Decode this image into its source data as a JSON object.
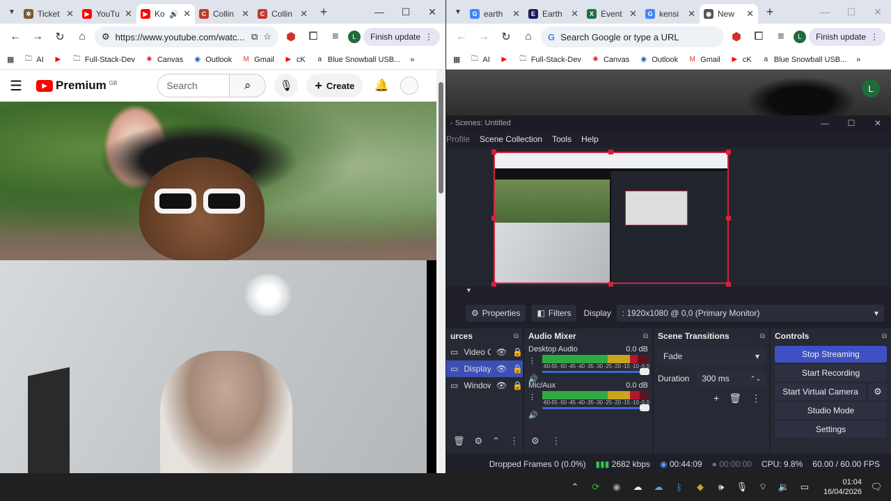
{
  "left_browser": {
    "tabs": [
      {
        "title": "Ticket",
        "icon": "gear-favicon-icon",
        "color": "#7a5a2a",
        "active": false
      },
      {
        "title": "YouTu",
        "icon": "youtube-favicon-icon",
        "color": "#ff0000",
        "active": false
      },
      {
        "title": "Ko",
        "icon": "youtube-favicon-icon",
        "color": "#ff0000",
        "active": true
      },
      {
        "title": "Collin",
        "icon": "collins-favicon-icon",
        "color": "#c0392b",
        "active": false
      },
      {
        "title": "Collin",
        "icon": "collins-favicon-icon",
        "color": "#c0392b",
        "active": false
      }
    ],
    "url": "https://www.youtube.com/watc...",
    "avatar_letter": "L",
    "finish_update": "Finish update",
    "bookmarks": [
      "AI",
      "",
      "Full-Stack-Dev",
      "Canvas",
      "Outlook",
      "Gmail",
      "cK",
      "Blue Snowball USB..."
    ]
  },
  "youtube": {
    "logo_text": "Premium",
    "logo_region": "GB",
    "search_placeholder": "Search",
    "create_label": "Create"
  },
  "right_browser": {
    "tabs": [
      {
        "title": "earth",
        "icon": "google-favicon-icon",
        "color": "#4285f4",
        "active": false
      },
      {
        "title": "Earth",
        "icon": "earth-favicon-icon",
        "color": "#1a1a5a",
        "active": false
      },
      {
        "title": "Event",
        "icon": "excel-favicon-icon",
        "color": "#1e7145",
        "active": false
      },
      {
        "title": "kensi",
        "icon": "google-favicon-icon",
        "color": "#4285f4",
        "active": false
      },
      {
        "title": "New",
        "icon": "chrome-favicon-icon",
        "color": "#555555",
        "active": true
      }
    ],
    "omnibox_placeholder": "Search Google or type a URL",
    "avatar_letter": "L",
    "finish_update": "Finish update",
    "bookmarks": [
      "AI",
      "",
      "Full-Stack-Dev",
      "Canvas",
      "Outlook",
      "Gmail",
      "cK",
      "Blue Snowball USB..."
    ],
    "page_avatar_letter": "L"
  },
  "obs": {
    "title": "- Scenes: Untitled",
    "menu": [
      "Profile",
      "Scene Collection",
      "Tools",
      "Help"
    ],
    "properties_label": "Properties",
    "filters_label": "Filters",
    "display_label": "Display",
    "display_value": ": 1920x1080 @ 0,0 (Primary Monitor)",
    "sources": {
      "title": "urces",
      "items": [
        {
          "name": "Video Cap",
          "selected": false
        },
        {
          "name": "Display Ca",
          "selected": true
        },
        {
          "name": "Window C",
          "selected": false
        }
      ]
    },
    "mixer": {
      "title": "Audio Mixer",
      "scale": "-60-55 -50 -45 -40 -35 -30 -25 -20 -15 -10 -5 0",
      "channels": [
        {
          "name": "Desktop Audio",
          "db": "0.0 dB",
          "level": 0.9
        },
        {
          "name": "Mic/Aux",
          "db": "0.0 dB",
          "level": 0.92
        }
      ]
    },
    "transitions": {
      "title": "Scene Transitions",
      "type": "Fade",
      "duration_label": "Duration",
      "duration_value": "300 ms"
    },
    "controls": {
      "title": "Controls",
      "stop_streaming": "Stop Streaming",
      "start_recording": "Start Recording",
      "start_virtual_camera": "Start Virtual Camera",
      "studio_mode": "Studio Mode",
      "settings": "Settings"
    },
    "status": {
      "dropped": "Dropped Frames 0 (0.0%)",
      "kbps": "2682 kbps",
      "stream_time": "00:44:09",
      "rec_time": "00:00:00",
      "cpu": "CPU: 9.8%",
      "fps": "60.00 / 60.00 FPS"
    },
    "accent_color": "#3d51c4",
    "selection_color": "#d3243b"
  },
  "taskbar": {
    "time": "01:04",
    "date": "16/04/2026"
  }
}
